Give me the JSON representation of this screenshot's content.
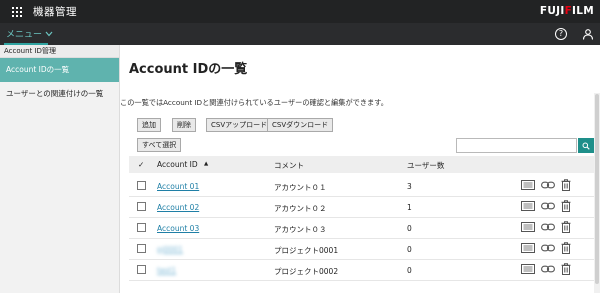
{
  "app": {
    "title": "機器管理",
    "brand_prefix": "FUJI",
    "brand_accent": "F",
    "brand_suffix": "ILM"
  },
  "menubar": {
    "menu_label": "メニュー"
  },
  "sidebar": {
    "section": "Account ID管理",
    "items": [
      {
        "label": "Account IDの一覧",
        "active": true
      },
      {
        "label": "ユーザーとの関連付けの一覧",
        "active": false
      }
    ]
  },
  "main": {
    "title": "Account IDの一覧",
    "description": "この一覧ではAccount IDと関連付けられているユーザーの確認と編集ができます。",
    "buttons": {
      "add": "追加",
      "delete": "削除",
      "csv_upload": "CSVアップロード",
      "csv_download": "CSVダウンロード",
      "select_all": "すべて選択"
    },
    "search": {
      "value": "",
      "placeholder": ""
    }
  },
  "table": {
    "headers": {
      "check": "✓",
      "id": "Account ID",
      "sort": "▲",
      "comment": "コメント",
      "users": "ユーザー数"
    },
    "rows": [
      {
        "id": "Account 01",
        "comment": "アカウント０１",
        "users": "3"
      },
      {
        "id": "Account 02",
        "comment": "アカウント０２",
        "users": "1"
      },
      {
        "id": "Account 03",
        "comment": "アカウント０３",
        "users": "0"
      },
      {
        "id": "pj0001",
        "comment": "プロジェクト0001",
        "users": "0"
      },
      {
        "id": "test1",
        "comment": "プロジェクト0002",
        "users": "0"
      }
    ]
  },
  "colors": {
    "accent": "#1e8f8a",
    "sidebar_active": "#5fb3ae",
    "topbar": "#222324",
    "link": "#1f7fa6",
    "brand_red": "#e60012"
  }
}
